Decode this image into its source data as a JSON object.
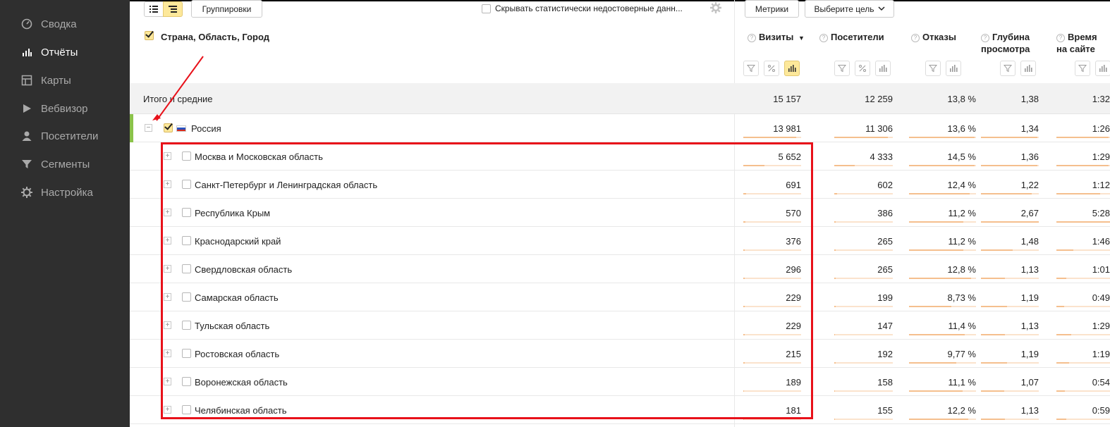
{
  "sidebar": {
    "items": [
      {
        "label": "Сводка",
        "icon": "dashboard-icon",
        "active": false
      },
      {
        "label": "Отчёты",
        "icon": "reports-icon",
        "active": true
      },
      {
        "label": "Карты",
        "icon": "maps-icon",
        "active": false
      },
      {
        "label": "Вебвизор",
        "icon": "webvisor-icon",
        "active": false
      },
      {
        "label": "Посетители",
        "icon": "visitors-icon",
        "active": false
      },
      {
        "label": "Сегменты",
        "icon": "segments-icon",
        "active": false
      },
      {
        "label": "Настройка",
        "icon": "settings-icon",
        "active": false
      }
    ]
  },
  "toolbar": {
    "groupings_label": "Группировки",
    "hide_unreliable_label": "Скрывать статистически недостоверные данн...",
    "metrics_label": "Метрики",
    "goal_label": "Выберите цель"
  },
  "table": {
    "dimension_header": "Страна, Область, Город",
    "columns": [
      {
        "label": "Визиты",
        "sort": "▼"
      },
      {
        "label": "Посетители"
      },
      {
        "label": "Отказы"
      },
      {
        "label": "Глубина просмотра"
      },
      {
        "label": "Время на сайте"
      }
    ],
    "total": {
      "label": "Итого и средние",
      "values": [
        "15 157",
        "12 259",
        "13,8 %",
        "1,38",
        "1:32"
      ]
    },
    "country": {
      "label": "Россия",
      "values": [
        "13 981",
        "11 306",
        "13,6 %",
        "1,34",
        "1:26"
      ],
      "bars": [
        0.92,
        0.92,
        0.98,
        0.97,
        0.98
      ]
    },
    "rows": [
      {
        "label": "Москва и Московская область",
        "values": [
          "5 652",
          "4 333",
          "14,5 %",
          "1,36",
          "1:29"
        ],
        "bars": [
          0.37,
          0.35,
          0.98,
          0.98,
          0.98
        ]
      },
      {
        "label": "Санкт-Петербург и Ленинградская область",
        "values": [
          "691",
          "602",
          "12,4 %",
          "1,22",
          "1:12"
        ],
        "bars": [
          0.05,
          0.05,
          0.9,
          0.88,
          0.82
        ]
      },
      {
        "label": "Республика Крым",
        "values": [
          "570",
          "386",
          "11,2 %",
          "2,67",
          "5:28"
        ],
        "bars": [
          0.04,
          0.03,
          0.81,
          1.0,
          1.0
        ]
      },
      {
        "label": "Краснодарский край",
        "values": [
          "376",
          "265",
          "11,2 %",
          "1,48",
          "1:46"
        ],
        "bars": [
          0.03,
          0.02,
          0.81,
          0.55,
          0.32
        ]
      },
      {
        "label": "Свердловская область",
        "values": [
          "296",
          "265",
          "12,8 %",
          "1,13",
          "1:01"
        ],
        "bars": [
          0.02,
          0.02,
          0.93,
          0.42,
          0.19
        ]
      },
      {
        "label": "Самарская область",
        "values": [
          "229",
          "199",
          "8,73 %",
          "1,19",
          "0:49"
        ],
        "bars": [
          0.02,
          0.02,
          0.63,
          0.45,
          0.15
        ]
      },
      {
        "label": "Тульская область",
        "values": [
          "229",
          "147",
          "11,4 %",
          "1,13",
          "1:29"
        ],
        "bars": [
          0.02,
          0.01,
          0.83,
          0.42,
          0.27
        ]
      },
      {
        "label": "Ростовская область",
        "values": [
          "215",
          "192",
          "9,77 %",
          "1,19",
          "1:19"
        ],
        "bars": [
          0.02,
          0.02,
          0.71,
          0.45,
          0.24
        ]
      },
      {
        "label": "Воронежская область",
        "values": [
          "189",
          "158",
          "11,1 %",
          "1,07",
          "0:54"
        ],
        "bars": [
          0.01,
          0.01,
          0.8,
          0.4,
          0.16
        ]
      },
      {
        "label": "Челябинская область",
        "values": [
          "181",
          "155",
          "12,2 %",
          "1,13",
          "0:59"
        ],
        "bars": [
          0.01,
          0.01,
          0.88,
          0.42,
          0.18
        ]
      }
    ]
  },
  "colors": {
    "accent": "#fde89a",
    "bar": "#f5bf8e",
    "highlight": "#e8111a",
    "country_marker": "#8bc34a"
  }
}
